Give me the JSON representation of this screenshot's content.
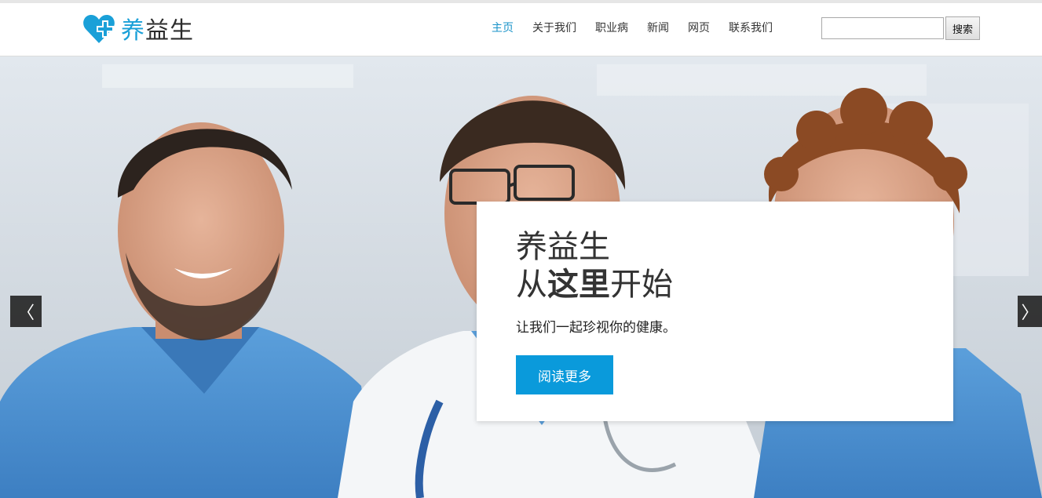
{
  "brand": {
    "name_accent": "养",
    "name_rest": "益生",
    "logo_icon": "heart-cross-icon",
    "accent_color": "#1aa0d8"
  },
  "nav": {
    "items": [
      {
        "label": "主页",
        "active": true
      },
      {
        "label": "关于我们",
        "active": false
      },
      {
        "label": "职业病",
        "active": false
      },
      {
        "label": "新闻",
        "active": false
      },
      {
        "label": "网页",
        "active": false
      },
      {
        "label": "联系我们",
        "active": false
      }
    ],
    "active_color": "#1a93c9"
  },
  "search": {
    "value": "",
    "button_label": "搜索"
  },
  "hero": {
    "title_line1": "养益生",
    "title_line2_a": "从",
    "title_line2_b": "这里",
    "title_line2_c": "开始",
    "subtitle": "让我们一起珍视你的健康。",
    "cta_label": "阅读更多",
    "cta_color": "#0a9adb",
    "prev_glyph": "〈",
    "next_glyph": "〉"
  }
}
